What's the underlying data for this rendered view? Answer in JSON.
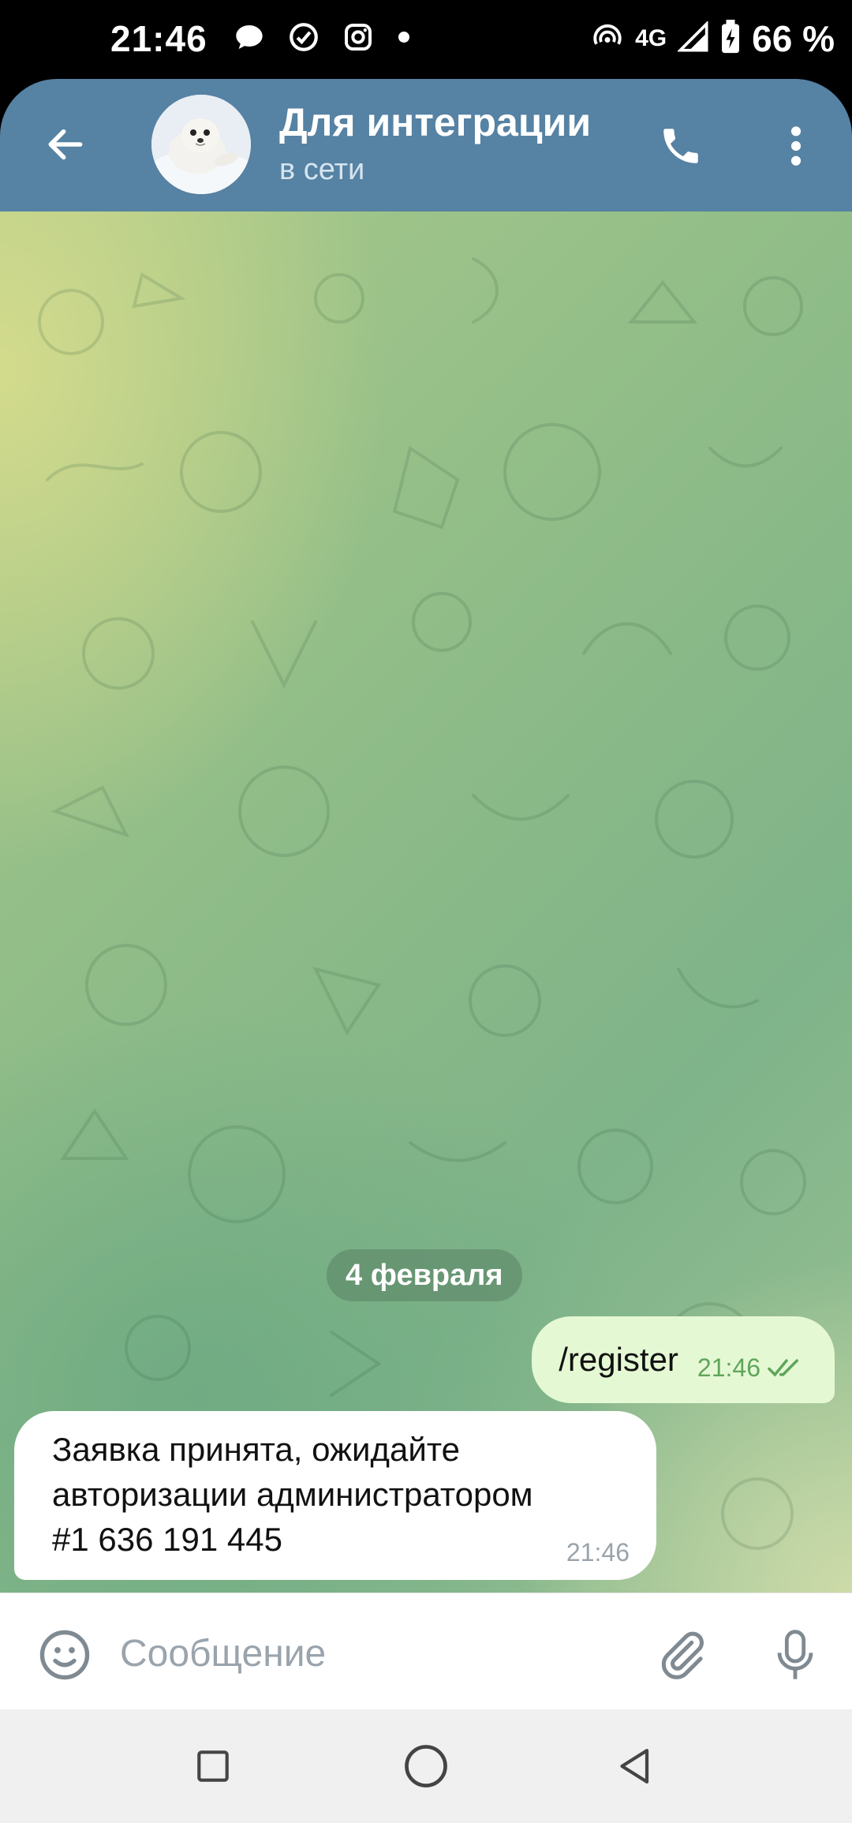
{
  "status_bar": {
    "time": "21:46",
    "network": "4G",
    "battery": "66 %",
    "left_icons": [
      "chat-bubble-icon",
      "check-circle-icon",
      "instagram-icon",
      "dot-icon"
    ],
    "right_icons": [
      "hotspot-icon",
      "signal-icon",
      "battery-icon"
    ]
  },
  "header": {
    "title": "Для интеграции",
    "status": "в сети",
    "icons": [
      "back-arrow-icon",
      "avatar",
      "phone-icon",
      "more-vert-icon"
    ]
  },
  "chat": {
    "date_chip": "4 февраля",
    "messages": [
      {
        "direction": "out",
        "text": "/register",
        "time": "21:46",
        "read": true
      },
      {
        "direction": "in",
        "text": "Заявка принята, ожидайте\nавторизации администратором\n#1 636 191 445",
        "time": "21:46"
      }
    ]
  },
  "input_bar": {
    "placeholder": "Сообщение",
    "icons": [
      "emoji-icon",
      "attach-icon",
      "mic-icon"
    ]
  },
  "nav_bar": {
    "icons": [
      "recent-apps-icon",
      "home-icon",
      "back-icon"
    ]
  },
  "colors": {
    "header": "#5682a3",
    "outgoing_bubble": "#e5f8d4",
    "incoming_bubble": "#ffffff",
    "read_check": "#5fa55b"
  }
}
